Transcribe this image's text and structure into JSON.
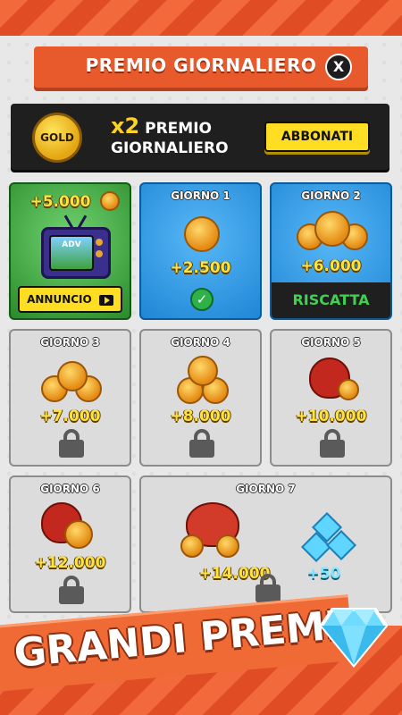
{
  "header": {
    "title": "PREMIO GIORNALIERO",
    "close_label": "X"
  },
  "gold_banner": {
    "badge_text": "GOLD",
    "multiplier": "x2",
    "title_line1": "PREMIO",
    "title_line2": "GIORNALIERO",
    "subscribe_label": "ABBONATI"
  },
  "cards": {
    "ad": {
      "amount": "+5.000",
      "screen_text": "ADV",
      "button_label": "ANNUNCIO"
    },
    "day1": {
      "label": "GIORNO 1",
      "amount": "+2.500",
      "status": "claimed"
    },
    "day2": {
      "label": "GIORNO 2",
      "amount": "+6.000",
      "button_label": "RISCATTA"
    },
    "day3": {
      "label": "GIORNO 3",
      "amount": "+7.000",
      "status": "locked"
    },
    "day4": {
      "label": "GIORNO 4",
      "amount": "+8.000",
      "status": "locked"
    },
    "day5": {
      "label": "GIORNO 5",
      "amount": "+10.000",
      "status": "locked"
    },
    "day6": {
      "label": "GIORNO 6",
      "amount": "+12.000",
      "status": "locked"
    },
    "day7": {
      "label": "GIORNO 7",
      "amount": "+14.000",
      "gems": "+50",
      "status": "locked"
    }
  },
  "footer": {
    "title": "GRANDI PREMI"
  },
  "colors": {
    "accent": "#e85a2c",
    "button_yellow": "#ffdd22",
    "claim_green": "#3fd14f"
  }
}
